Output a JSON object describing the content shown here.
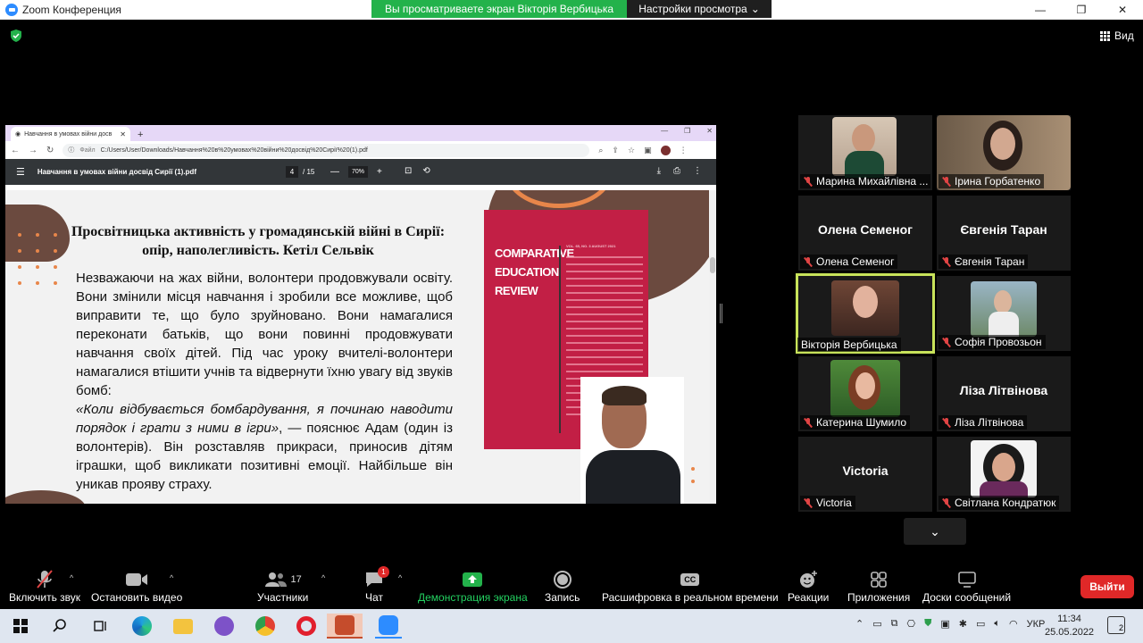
{
  "window": {
    "title": "Zoom Конференция"
  },
  "share": {
    "banner": "Вы просматриваете экран Вікторія Вербицька",
    "view_options": "Настройки просмотра"
  },
  "view_button": "Вид",
  "browser": {
    "tab_title": "Навчання в умовах війни досв",
    "file_label": "Файл",
    "url": "C:/Users/User/Downloads/Навчання%20в%20умовах%20війни%20досвід%20Сирії%20(1).pdf"
  },
  "pdf": {
    "filename": "Навчання в умовах війни досвід Сирії (1).pdf",
    "page": "4",
    "pages_total": "/ 15",
    "zoom": "70%",
    "heading": "Просвітницька активність у громадянській війні в Сирії: опір, наполегливість. Кетіл Сельвік",
    "para1": "Незважаючи на жах війни, волонтери продовжували освіту. Вони змінили місця навчання і зробили все можливе, щоб виправити те, що було зруйновано. Вони намагалися переконати батьків, що вони повинні продовжувати навчання своїх дітей. Під час уроку вчителі-волонтери намагалися втішити учнів та відвернути їхню увагу від звуків бомб:",
    "quote": "«Коли відбувається бомбардування, я починаю наводити порядок і грати з ними в ігри»",
    "para2": ", — пояснює Адам (один із волонтерів). Він розставляв прикраси, приносив дітям іграшки, щоб викликати позитивні емоції. Найбільше він уникав прояву страху.",
    "cover_title": "COMPARATIVE EDUCATION REVIEW",
    "cover_vol": "VOL. 65, NO. 3    AUGUST 2021"
  },
  "participants": [
    {
      "label": "Марина Михайлівна ...",
      "big_name": "",
      "has_video": true
    },
    {
      "label": "Ірина Горбатенко",
      "big_name": "",
      "has_video": true
    },
    {
      "label": "Олена Семеног",
      "big_name": "Олена Семеног",
      "has_video": false
    },
    {
      "label": "Євгенія Таран",
      "big_name": "Євгенія Таран",
      "has_video": false
    },
    {
      "label": "Вікторія Вербицька",
      "big_name": "",
      "has_video": true,
      "active": true
    },
    {
      "label": "Софія Провозьон",
      "big_name": "",
      "has_video": true
    },
    {
      "label": "Катерина Шумило",
      "big_name": "",
      "has_video": true
    },
    {
      "label": "Ліза Літвінова",
      "big_name": "Ліза Літвінова",
      "has_video": false
    },
    {
      "label": "Victoria",
      "big_name": "Victoria",
      "has_video": false
    },
    {
      "label": "Світлана Кондратюк",
      "big_name": "",
      "has_video": true
    }
  ],
  "toolbar": {
    "unmute": "Включить звук",
    "stop_video": "Остановить видео",
    "participants": "Участники",
    "participants_count": "17",
    "chat": "Чат",
    "chat_badge": "1",
    "share_screen": "Демонстрация экрана",
    "record": "Запись",
    "transcript": "Расшифровка в реальном времени",
    "reactions": "Реакции",
    "apps": "Приложения",
    "whiteboards": "Доски сообщений",
    "leave": "Выйти",
    "cc": "CC"
  },
  "taskbar": {
    "lang": "УКР",
    "time": "11:34",
    "date": "25.05.2022",
    "notifications": "2"
  },
  "colors": {
    "share_green": "#23b24b",
    "active_border": "#c8e35a",
    "leave_red": "#e02828",
    "mic_red": "#e04444"
  }
}
